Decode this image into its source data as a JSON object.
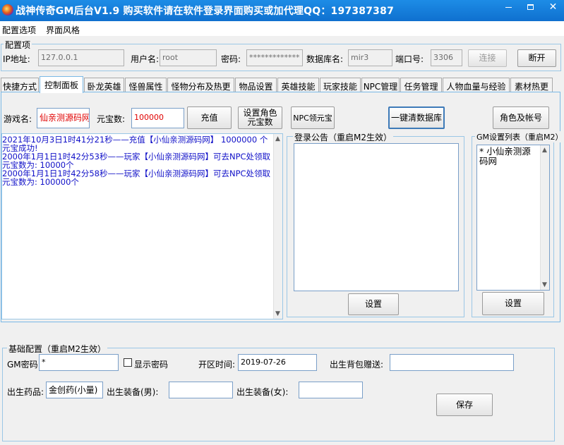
{
  "window": {
    "title": "战神传奇GM后台V1.9   购买软件请在软件登录界面购买或加代理QQ：197387387",
    "close_glyph": "✕"
  },
  "menu": [
    "配置选项",
    "界面风格"
  ],
  "config": {
    "group_title": "配置项",
    "ip_label": "IP地址:",
    "ip_value": "127.0.0.1",
    "user_label": "用户名:",
    "user_value": "root",
    "password_label": "密码:",
    "password_value": "*************",
    "db_label": "数据库名:",
    "db_value": "mir3",
    "port_label": "端口号:",
    "port_value": "3306",
    "connect_label": "连接",
    "disconnect_label": "断开"
  },
  "tabs": [
    "快捷方式",
    "控制面板",
    "卧龙英雄",
    "怪兽属性",
    "怪物分布及热更",
    "物品设置",
    "英雄技能",
    "玩家技能",
    "NPC管理",
    "任务管理",
    "人物血量与经验",
    "素材热更"
  ],
  "active_tab": 1,
  "control": {
    "game_name_label": "游戏名:",
    "game_name_value": "仙亲测源码网",
    "yuanbao_label": "元宝数:",
    "yuanbao_value": "100000",
    "recharge_label": "充值",
    "set_role_yuanbao_label": "设置角色元宝数",
    "npc_yuanbao_label": "NPC领元宝",
    "clear_db_label": "一键清数据库",
    "role_account_label": "角色及帐号"
  },
  "log": [
    "2021年10月3日1时41分21秒——充值【小仙亲测源码网】 1000000 个元宝成功!",
    "2000年1月1日1时42分53秒——玩家【小仙亲测源码网】可去NPC处领取元宝数为: 10000个",
    "2000年1月1日1时42分58秒——玩家【小仙亲测源码网】可去NPC处领取元宝数为: 100000个"
  ],
  "notice": {
    "title": "登录公告（重启M2生效）",
    "value": "",
    "set_label": "设置"
  },
  "gm_list": {
    "title": "GM设置列表（重启M2）",
    "value": "* 小仙亲测源码网",
    "set_label": "设置"
  },
  "basic": {
    "group_title": "基础配置（重启M2生效）",
    "gm_password_label": "GM密码:",
    "gm_password_value": "*",
    "show_password_label": "显示密码",
    "open_time_label": "开区时间:",
    "open_time_value": "2019-07-26",
    "bag_gift_label": "出生背包赠送:",
    "bag_gift_value": "",
    "medicine_label": "出生药品:",
    "medicine_value": "金创药(小量)",
    "equip_male_label": "出生装备(男):",
    "equip_male_value": "",
    "equip_female_label": "出生装备(女):",
    "equip_female_value": "",
    "save_label": "保存"
  }
}
